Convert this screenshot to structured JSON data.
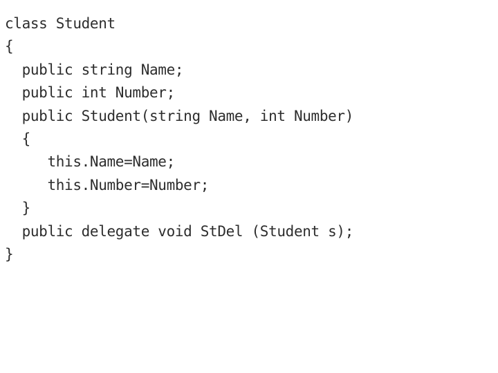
{
  "document": {
    "kind": "code-listing",
    "language": "C#",
    "background_color": "#ffffff",
    "text_color": "#2d2d2d",
    "code": {
      "lines": [
        "class Student",
        "{",
        "  public string Name;",
        "  public int Number;",
        "  public Student(string Name, int Number)",
        "  {",
        "     this.Name=Name;",
        "     this.Number=Number;",
        "  }",
        "  public delegate void StDel (Student s);",
        "}"
      ],
      "full_text": "class Student\n{\n  public string Name;\n  public int Number;\n  public Student(string Name, int Number)\n  {\n     this.Name=Name;\n     this.Number=Number;\n  }\n  public delegate void StDel (Student s);\n}"
    }
  }
}
